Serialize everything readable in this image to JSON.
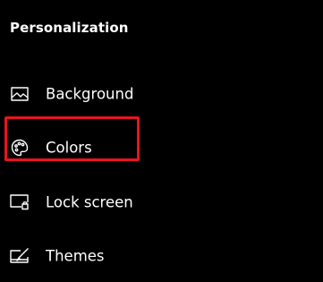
{
  "section": {
    "title": "Personalization"
  },
  "nav": {
    "items": [
      {
        "label": "Background",
        "icon": "picture-icon"
      },
      {
        "label": "Colors",
        "icon": "palette-icon"
      },
      {
        "label": "Lock screen",
        "icon": "lock-screen-icon"
      },
      {
        "label": "Themes",
        "icon": "themes-icon"
      }
    ]
  },
  "colors": {
    "background": "#000000",
    "text": "#ffffff",
    "highlight": "#e8141e"
  }
}
